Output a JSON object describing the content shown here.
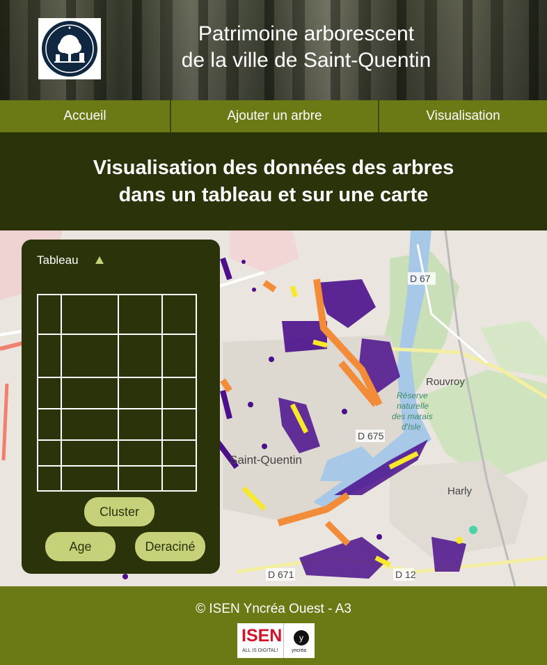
{
  "header": {
    "title_line1": "Patrimoine arborescent",
    "title_line2": "de la ville de Saint-Quentin",
    "logo_text": "ST QUENTIN"
  },
  "nav": {
    "items": [
      {
        "label": "Accueil"
      },
      {
        "label": "Ajouter un arbre"
      },
      {
        "label": "Visualisation"
      }
    ]
  },
  "main": {
    "heading_line1": "Visualisation des données des arbres",
    "heading_line2": "dans un tableau et sur une carte"
  },
  "panel": {
    "title": "Tableau",
    "buttons": {
      "cluster": "Cluster",
      "age": "Age",
      "deracine": "Deraciné"
    }
  },
  "map": {
    "labels": {
      "d67": "D 67",
      "rouvroy": "Rouvroy",
      "reserve1": "Réserve",
      "reserve2": "naturelle",
      "reserve3": "des marais",
      "reserve4": "d'Isle",
      "d675": "D 675",
      "saint_quentin": "Saint-Quentin",
      "harly": "Harly",
      "d671": "D 671",
      "d12": "D 12"
    },
    "colors": {
      "purple": "#4b0f8c",
      "orange": "#f28c38",
      "yellow": "#f7e82a",
      "water": "#a8c8e8",
      "park": "#c9dfb8"
    }
  },
  "footer": {
    "copyright": "© ISEN Yncréa Ouest - A3",
    "isen_word": "ISEN",
    "isen_tagline": "ALL IS DIGITAL!",
    "yncrea_mark": "y",
    "yncrea_word": "yncréa"
  },
  "colors": {
    "dark": "#2b330a",
    "olive": "#6b7a14",
    "button": "#c6d179"
  }
}
